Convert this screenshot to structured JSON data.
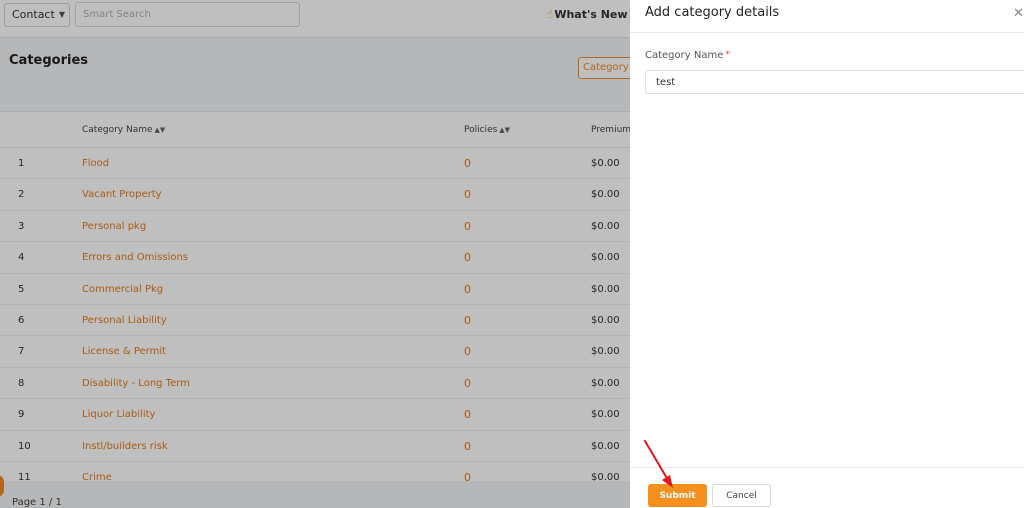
{
  "topbar": {
    "contact_label": "Contact",
    "search_placeholder": "Smart Search",
    "whats_new_label": "What's New"
  },
  "page": {
    "title": "Categories",
    "category_button_label": "Category"
  },
  "table": {
    "columns": [
      "Category Name",
      "Policies",
      "Premium"
    ],
    "rows": [
      {
        "num": "1",
        "name": "Flood",
        "policies": "0",
        "premium": "$0.00"
      },
      {
        "num": "2",
        "name": "Vacant Property",
        "policies": "0",
        "premium": "$0.00"
      },
      {
        "num": "3",
        "name": "Personal pkg",
        "policies": "0",
        "premium": "$0.00"
      },
      {
        "num": "4",
        "name": "Errors and Omissions",
        "policies": "0",
        "premium": "$0.00"
      },
      {
        "num": "5",
        "name": "Commercial Pkg",
        "policies": "0",
        "premium": "$0.00"
      },
      {
        "num": "6",
        "name": "Personal Liability",
        "policies": "0",
        "premium": "$0.00"
      },
      {
        "num": "7",
        "name": "License & Permit",
        "policies": "0",
        "premium": "$0.00"
      },
      {
        "num": "8",
        "name": "Disability - Long Term",
        "policies": "0",
        "premium": "$0.00"
      },
      {
        "num": "9",
        "name": "Liquor Liability",
        "policies": "0",
        "premium": "$0.00"
      },
      {
        "num": "10",
        "name": "Instl/builders risk",
        "policies": "0",
        "premium": "$0.00"
      },
      {
        "num": "11",
        "name": "Crime",
        "policies": "0",
        "premium": "$0.00"
      }
    ],
    "pager_text": "Page 1 / 1"
  },
  "panel": {
    "title": "Add category details",
    "field_label": "Category Name",
    "required_mark": "*",
    "field_value": "test",
    "submit_label": "Submit",
    "cancel_label": "Cancel"
  },
  "icons": {
    "close": "close-icon",
    "sort": "sort-icon",
    "hand": "hand-icon",
    "chevron": "chevron-down-icon"
  },
  "colors": {
    "accent": "#f5901f",
    "link": "#e07c1c",
    "arrow": "#e8141c"
  }
}
